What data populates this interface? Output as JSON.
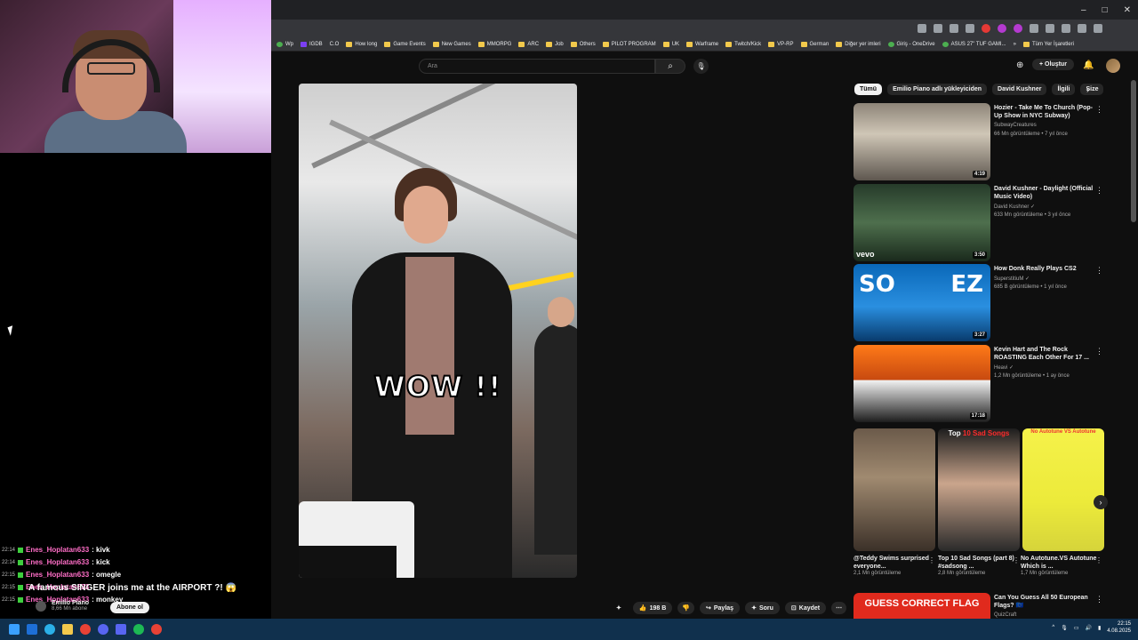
{
  "stream": {
    "chat": [
      {
        "time": "22:14",
        "user": "Enes_Hoplatan633",
        "msg": ": kivk"
      },
      {
        "time": "22:14",
        "user": "Enes_Hoplatan633",
        "msg": ": kick"
      },
      {
        "time": "22:15",
        "user": "Enes_Hoplatan633",
        "msg": ": omegle"
      },
      {
        "time": "22:15",
        "user": "Enes_Hoplatan633",
        "msg": ""
      },
      {
        "time": "22:15",
        "user": "Enes_Hoplatan633",
        "msg": ": monkey"
      }
    ],
    "overlay_title": "A famous SINGER joins me at the AIRPORT ?! 😱",
    "channel_name": "Emilio Piano",
    "channel_subs": "8,66 Mn abone",
    "subscribe_label": "Abone ol"
  },
  "browser": {
    "title_controls": [
      "–",
      "□",
      "✕"
    ],
    "bookmarks": [
      "Wp",
      "IGDB",
      "C.O",
      "How long",
      "Game Events",
      "New Games",
      "MMORPG",
      "ARC",
      "Job",
      "Others",
      "PILOT PROGRAM",
      "UK",
      "Warframe",
      "Twitch/Kick",
      "VP-RP",
      "German",
      "Diğer yer imleri",
      "Giriş - OneDrive",
      "ASUS 27\" TUF GAMI...",
      "»",
      "Tüm Yer İşaretleri"
    ]
  },
  "youtube": {
    "search_placeholder": "Ara",
    "create_label": "+ Oluştur",
    "video_caption": "WOW !!",
    "actions": {
      "likes": "198 B",
      "share": "Paylaş",
      "ask": "Soru",
      "save": "Kaydet"
    },
    "chips": [
      "Tümü",
      "Emilio Piano adlı yükleyiciden",
      "David Kushner",
      "İlgili",
      "Size"
    ],
    "recs": [
      {
        "title": "Hozier - Take Me To Church (Pop-Up Show in NYC Subway)",
        "channel": "SubwayCreatures",
        "meta": "66 Mn görüntüleme • 7 yıl önce",
        "duration": "4:19"
      },
      {
        "title": "David Kushner - Daylight (Official Music Video)",
        "channel": "David Kushner ✓",
        "meta": "633 Mn görüntüleme • 3 yıl önce",
        "duration": "3:50",
        "badge": "vevo"
      },
      {
        "title": "How Donk Really Plays CS2",
        "channel": "SuperstitiuM ✓",
        "meta": "685 B görüntüleme • 1 yıl önce",
        "duration": "3:27",
        "left": "SO",
        "right": "EZ"
      },
      {
        "title": "Kevin Hart and The Rock ROASTING Each Other For 17 ...",
        "channel": "Heavi ✓",
        "meta": "1,2 Mn görüntüleme • 1 ay önce",
        "duration": "17:18"
      }
    ],
    "shorts": [
      {
        "title": "@Teddy Swims surprised everyone...",
        "views": "2,1 Mn görüntüleme"
      },
      {
        "title": "Top 10 Sad Songs (part 8) #sadsong ...",
        "views": "2,8 Mn görüntüleme",
        "overlay_a": "Top ",
        "overlay_b": "10 Sad Songs"
      },
      {
        "title": "No Autotune.VS Autotune Which is ...",
        "views": "1,7 Mn görüntüleme",
        "overlay": "No Autotune VS Autotune"
      }
    ],
    "last_rec": {
      "thumb_text": "GUESS CORRECT FLAG",
      "title": "Can You Guess All 50 European Flags? 🇪🇺",
      "channel": "QuizCraft"
    }
  },
  "system": {
    "time": "22:15",
    "date": "4.08.2025"
  }
}
